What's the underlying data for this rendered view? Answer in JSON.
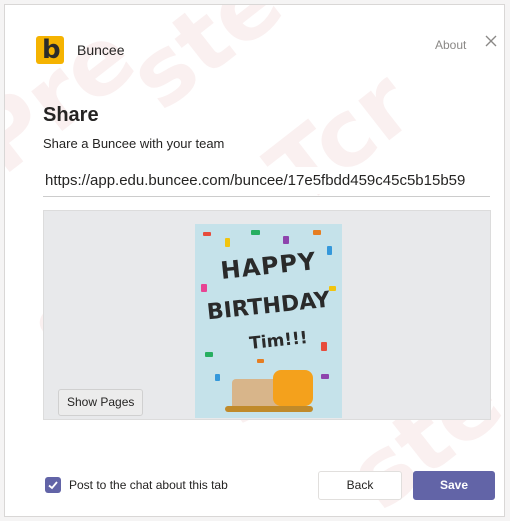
{
  "header": {
    "app_logo_letter": "b",
    "app_name": "Buncee",
    "about_label": "About",
    "close_icon": "close-icon"
  },
  "share": {
    "title": "Share",
    "subtitle": "Share a Buncee with your team",
    "url_value": "https://app.edu.buncee.com/buncee/17e5fbdd459c45c5b15b59"
  },
  "preview": {
    "card_line1": "HAPPY",
    "card_line2": "BIRTHDAY",
    "card_line3": "Tim!!!",
    "show_pages_label": "Show Pages"
  },
  "footer": {
    "checkbox_checked": true,
    "checkbox_label": "Post to the chat about this tab",
    "back_label": "Back",
    "save_label": "Save"
  },
  "colors": {
    "accent": "#6264a7",
    "logo": "#f5b301"
  }
}
